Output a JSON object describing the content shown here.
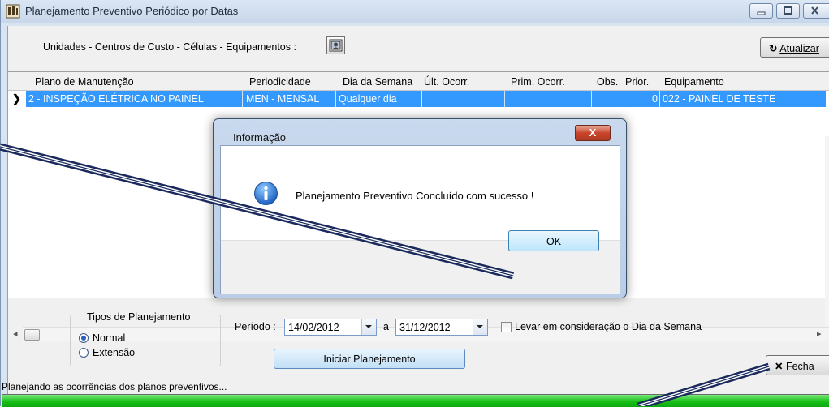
{
  "window": {
    "title": "Planejamento Preventivo Periódico por Datas"
  },
  "toolbar": {
    "units_label": "Unidades - Centros de Custo - Células - Equipamentos :",
    "refresh_label": "Atualizar"
  },
  "grid": {
    "columns": [
      "Plano de Manutenção",
      "Periodicidade",
      "Dia da Semana",
      "Últ. Ocorr.",
      "Prim. Ocorr.",
      "Obs.",
      "Prior.",
      "Equipamento"
    ],
    "rows": [
      {
        "plano": "2 - INSPEÇÃO ELÉTRICA NO PAINEL",
        "periodicidade": "MEN - MENSAL",
        "dia_semana": "Qualquer dia",
        "ult": "",
        "prim": "",
        "obs": "",
        "prior": "0",
        "equipamento": "022 - PAINEL DE TESTE"
      }
    ]
  },
  "planning": {
    "group_title": "Tipos de Planejamento",
    "options": [
      "Normal",
      "Extensão"
    ],
    "selected": "Normal",
    "period_label": "Período :",
    "date_from": "14/02/2012",
    "to_label": "a",
    "date_to": "31/12/2012",
    "weekday_check_label": "Levar em consideração o Dia da Semana",
    "start_label": "Iniciar Planejamento",
    "close_label": "Fecha"
  },
  "status": {
    "text": "Planejando as ocorrências dos planos preventivos...",
    "progress": 1.0
  },
  "dialog": {
    "title": "Informação",
    "message": "Planejamento Preventivo Concluído com sucesso !",
    "ok_label": "OK",
    "close_glyph": "X"
  },
  "colors": {
    "selection": "#3399ff",
    "progress": "#16c016",
    "dialog_close": "#c8452c",
    "annotation": "#1a2a5c"
  }
}
